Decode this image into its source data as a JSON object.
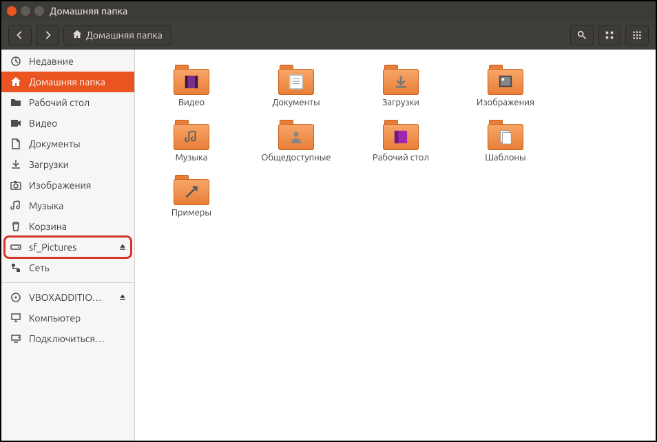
{
  "window": {
    "title": "Домашняя папка"
  },
  "toolbar": {
    "path_label": "Домашняя папка"
  },
  "sidebar": {
    "items": [
      {
        "label": "Недавние",
        "icon": "clock-icon",
        "active": false
      },
      {
        "label": "Домашняя папка",
        "icon": "home-icon",
        "active": true
      },
      {
        "label": "Рабочий стол",
        "icon": "folder-icon",
        "active": false
      },
      {
        "label": "Видео",
        "icon": "video-icon",
        "active": false
      },
      {
        "label": "Документы",
        "icon": "document-icon",
        "active": false
      },
      {
        "label": "Загрузки",
        "icon": "download-icon",
        "active": false
      },
      {
        "label": "Изображения",
        "icon": "camera-icon",
        "active": false
      },
      {
        "label": "Музыка",
        "icon": "music-icon",
        "active": false
      },
      {
        "label": "Корзина",
        "icon": "trash-icon",
        "active": false
      },
      {
        "label": "sf_Pictures",
        "icon": "drive-icon",
        "active": false,
        "eject": true,
        "hilite": true
      },
      {
        "label": "Сеть",
        "icon": "network-icon",
        "active": false
      }
    ],
    "items2": [
      {
        "label": "VBOXADDITIO…",
        "icon": "disc-icon",
        "eject": true
      },
      {
        "label": "Компьютер",
        "icon": "computer-icon"
      },
      {
        "label": "Подключиться…",
        "icon": "connect-icon"
      }
    ]
  },
  "folders": [
    {
      "label": "Видео",
      "badge": "video"
    },
    {
      "label": "Документы",
      "badge": "doc"
    },
    {
      "label": "Загрузки",
      "badge": "download"
    },
    {
      "label": "Изображения",
      "badge": "image"
    },
    {
      "label": "Музыка",
      "badge": "music"
    },
    {
      "label": "Общедоступные",
      "badge": "share"
    },
    {
      "label": "Рабочий стол",
      "badge": "desktop"
    },
    {
      "label": "Шаблоны",
      "badge": "template"
    },
    {
      "label": "Примеры",
      "badge": "link"
    }
  ]
}
